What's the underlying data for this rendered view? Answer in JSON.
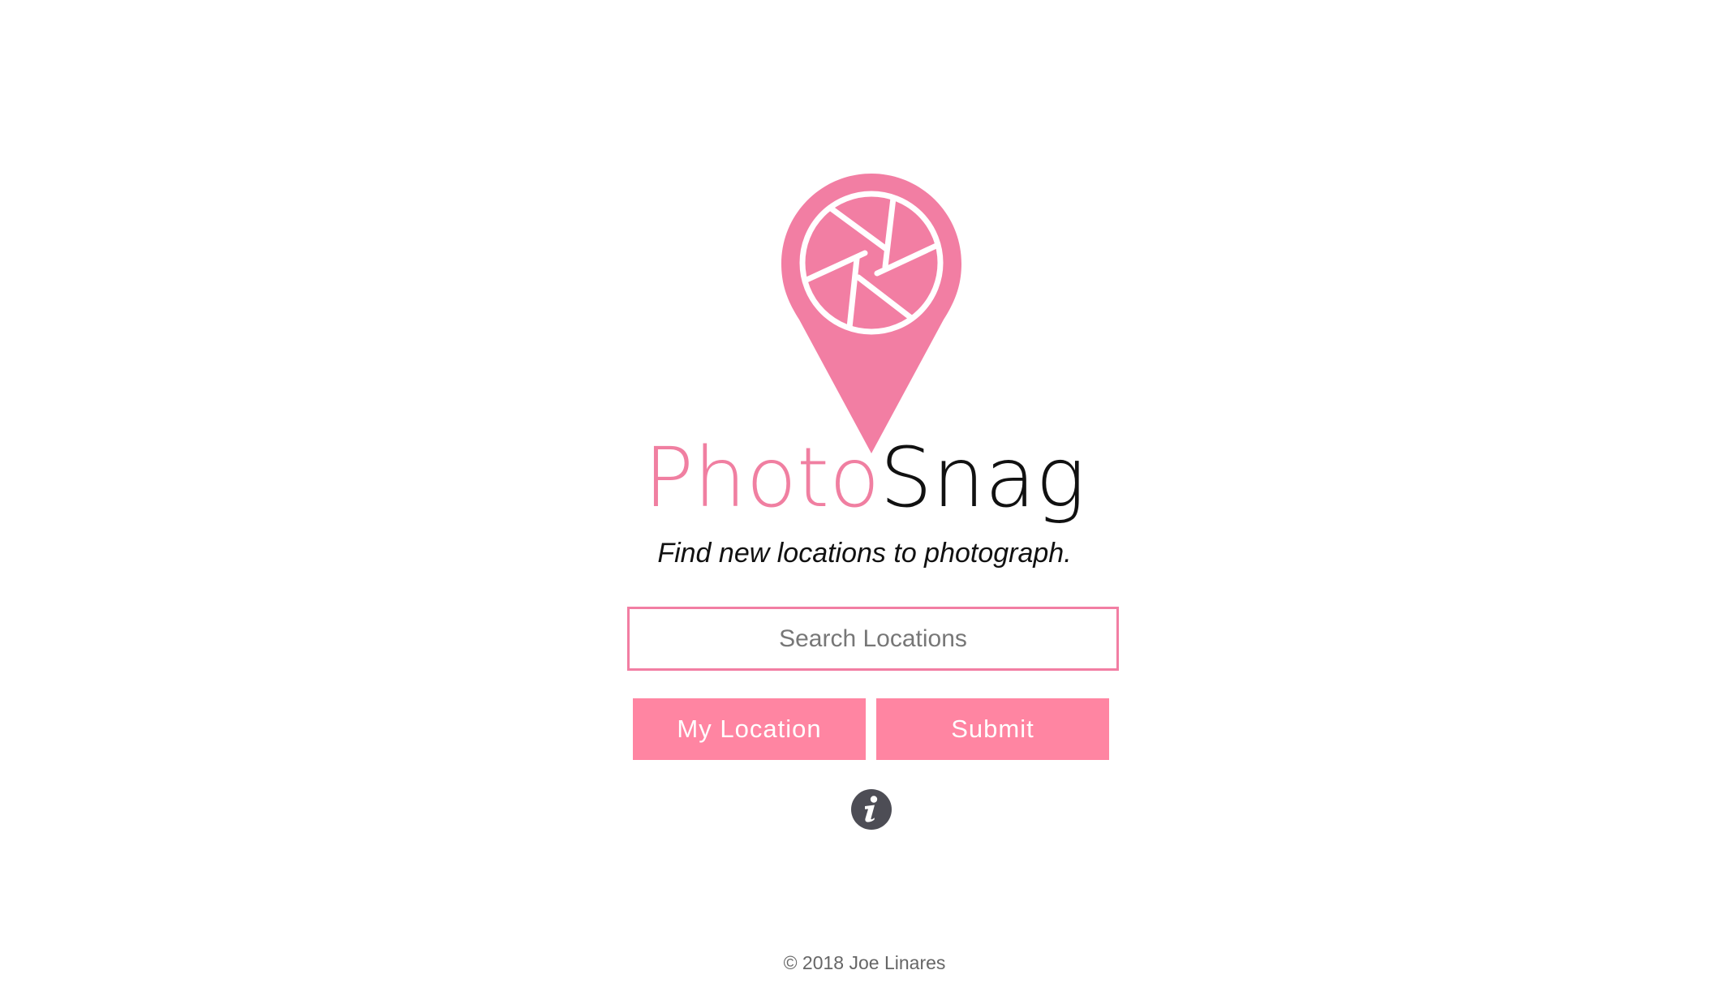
{
  "brand": {
    "name_part1": "Photo",
    "name_part2": "Snag",
    "tagline": "Find new locations to photograph.",
    "accent_color": "#f27ea3",
    "button_color": "#ff85a2"
  },
  "logo": {
    "icon": "map-pin-camera-aperture-icon"
  },
  "search": {
    "placeholder": "Search Locations",
    "value": ""
  },
  "actions": {
    "my_location_label": "My Location",
    "submit_label": "Submit"
  },
  "info": {
    "icon": "info-icon"
  },
  "footer": {
    "copyright": "© 2018 Joe Linares"
  }
}
